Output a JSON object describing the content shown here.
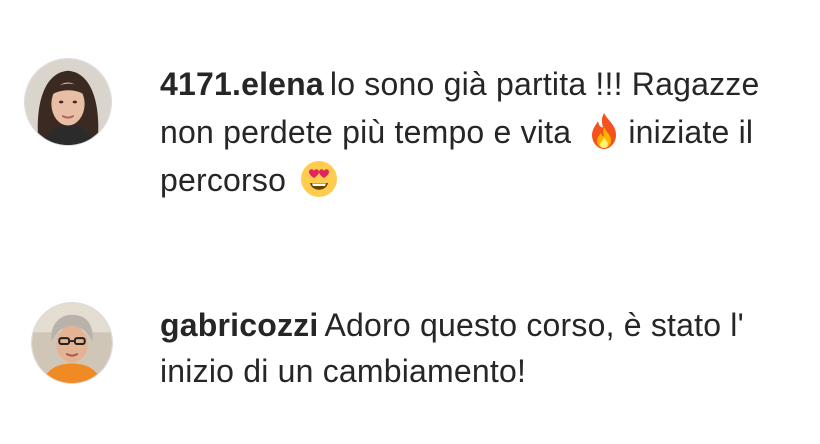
{
  "comments": [
    {
      "username": "4171.elena",
      "text_part1": "lo sono già partita !!! Ragazze non perdete più tempo e vita",
      "emoji1": "fire-emoji",
      "text_part2": "iniziate il percorso",
      "emoji2": "heart-eyes-emoji",
      "avatar": "avatar-photo-elena"
    },
    {
      "username": "gabricozzi",
      "text": "Adoro questo corso, è stato l' inizio di un cambiamento!",
      "avatar": "avatar-photo-gabricozzi"
    }
  ],
  "colors": {
    "text": "#262626",
    "background": "#ffffff",
    "avatar_border": "#dbdbdb"
  }
}
